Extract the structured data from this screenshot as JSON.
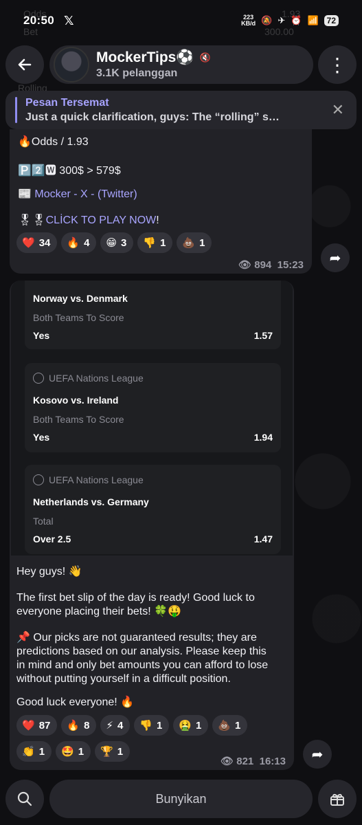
{
  "status_bar": {
    "time": "20:50",
    "x_logo": "𝕏",
    "net_speed": "223",
    "net_unit": "KB/d",
    "battery": "72"
  },
  "background_text": {
    "odds": "Odds",
    "odds_val": "1.93",
    "bet": "Bet",
    "bet_val": "300.00",
    "rolling": "Rolling"
  },
  "header": {
    "back_icon": "arrow-left-icon",
    "channel_name": "MockerTips⚽",
    "muted_icon": "🔇",
    "subscribers": "3.1K pelanggan",
    "menu_icon": "⋮"
  },
  "pinned": {
    "title": "Pesan Tersemat",
    "body": "Just a quick clarification, guys:  The “rolling” s…",
    "close": "✕"
  },
  "message1": {
    "odds_line": "🔥Odds / 1.93",
    "p2w_line": "🅿️2️⃣🆆 300$ > 579$",
    "twitter_prefix": "📰 ",
    "twitter_link": "Mocker - X - (Twitter)",
    "play_prefix": "🎖🎖",
    "play_link": "CLİCK TO PLAY NOW",
    "play_suffix": "!",
    "reactions": [
      {
        "emoji": "❤️",
        "count": "34"
      },
      {
        "emoji": "🔥",
        "count": "4"
      },
      {
        "emoji": "😁",
        "count": "3"
      },
      {
        "emoji": "👎",
        "count": "1"
      },
      {
        "emoji": "💩",
        "count": "1"
      }
    ],
    "views": "894",
    "time": "15:23"
  },
  "bet_slip": {
    "cards": [
      {
        "league": "",
        "match": "Norway vs. Denmark",
        "market": "Both Teams To Score",
        "pick": "Yes",
        "odds": "1.57"
      },
      {
        "league": "UEFA Nations League",
        "match": "Kosovo vs. Ireland",
        "market": "Both Teams To Score",
        "pick": "Yes",
        "odds": "1.94"
      },
      {
        "league": "UEFA Nations League",
        "match": "Netherlands vs. Germany",
        "market": "Total",
        "pick": "Over 2.5",
        "odds": "1.47"
      }
    ]
  },
  "message2": {
    "greeting": "Hey guys! 👋",
    "para1": "The first bet slip of the day is ready! Good luck to everyone placing their bets! 🍀🤑",
    "para2": "📌 Our picks are not guaranteed results; they are predictions based on our analysis. Please keep this in mind and only bet amounts you can afford to lose without putting yourself in a difficult position.",
    "para3": "Good luck everyone! 🔥",
    "reactions_row1": [
      {
        "emoji": "❤️",
        "count": "87"
      },
      {
        "emoji": "🔥",
        "count": "8"
      },
      {
        "emoji": "⚡",
        "count": "4"
      },
      {
        "emoji": "👎",
        "count": "1"
      },
      {
        "emoji": "🤮",
        "count": "1"
      },
      {
        "emoji": "💩",
        "count": "1"
      }
    ],
    "reactions_row2": [
      {
        "emoji": "👏",
        "count": "1"
      },
      {
        "emoji": "🤩",
        "count": "1"
      },
      {
        "emoji": "🏆",
        "count": "1"
      }
    ],
    "views": "821",
    "time": "16:13"
  },
  "bottom_bar": {
    "unmute_label": "Bunyikan"
  }
}
